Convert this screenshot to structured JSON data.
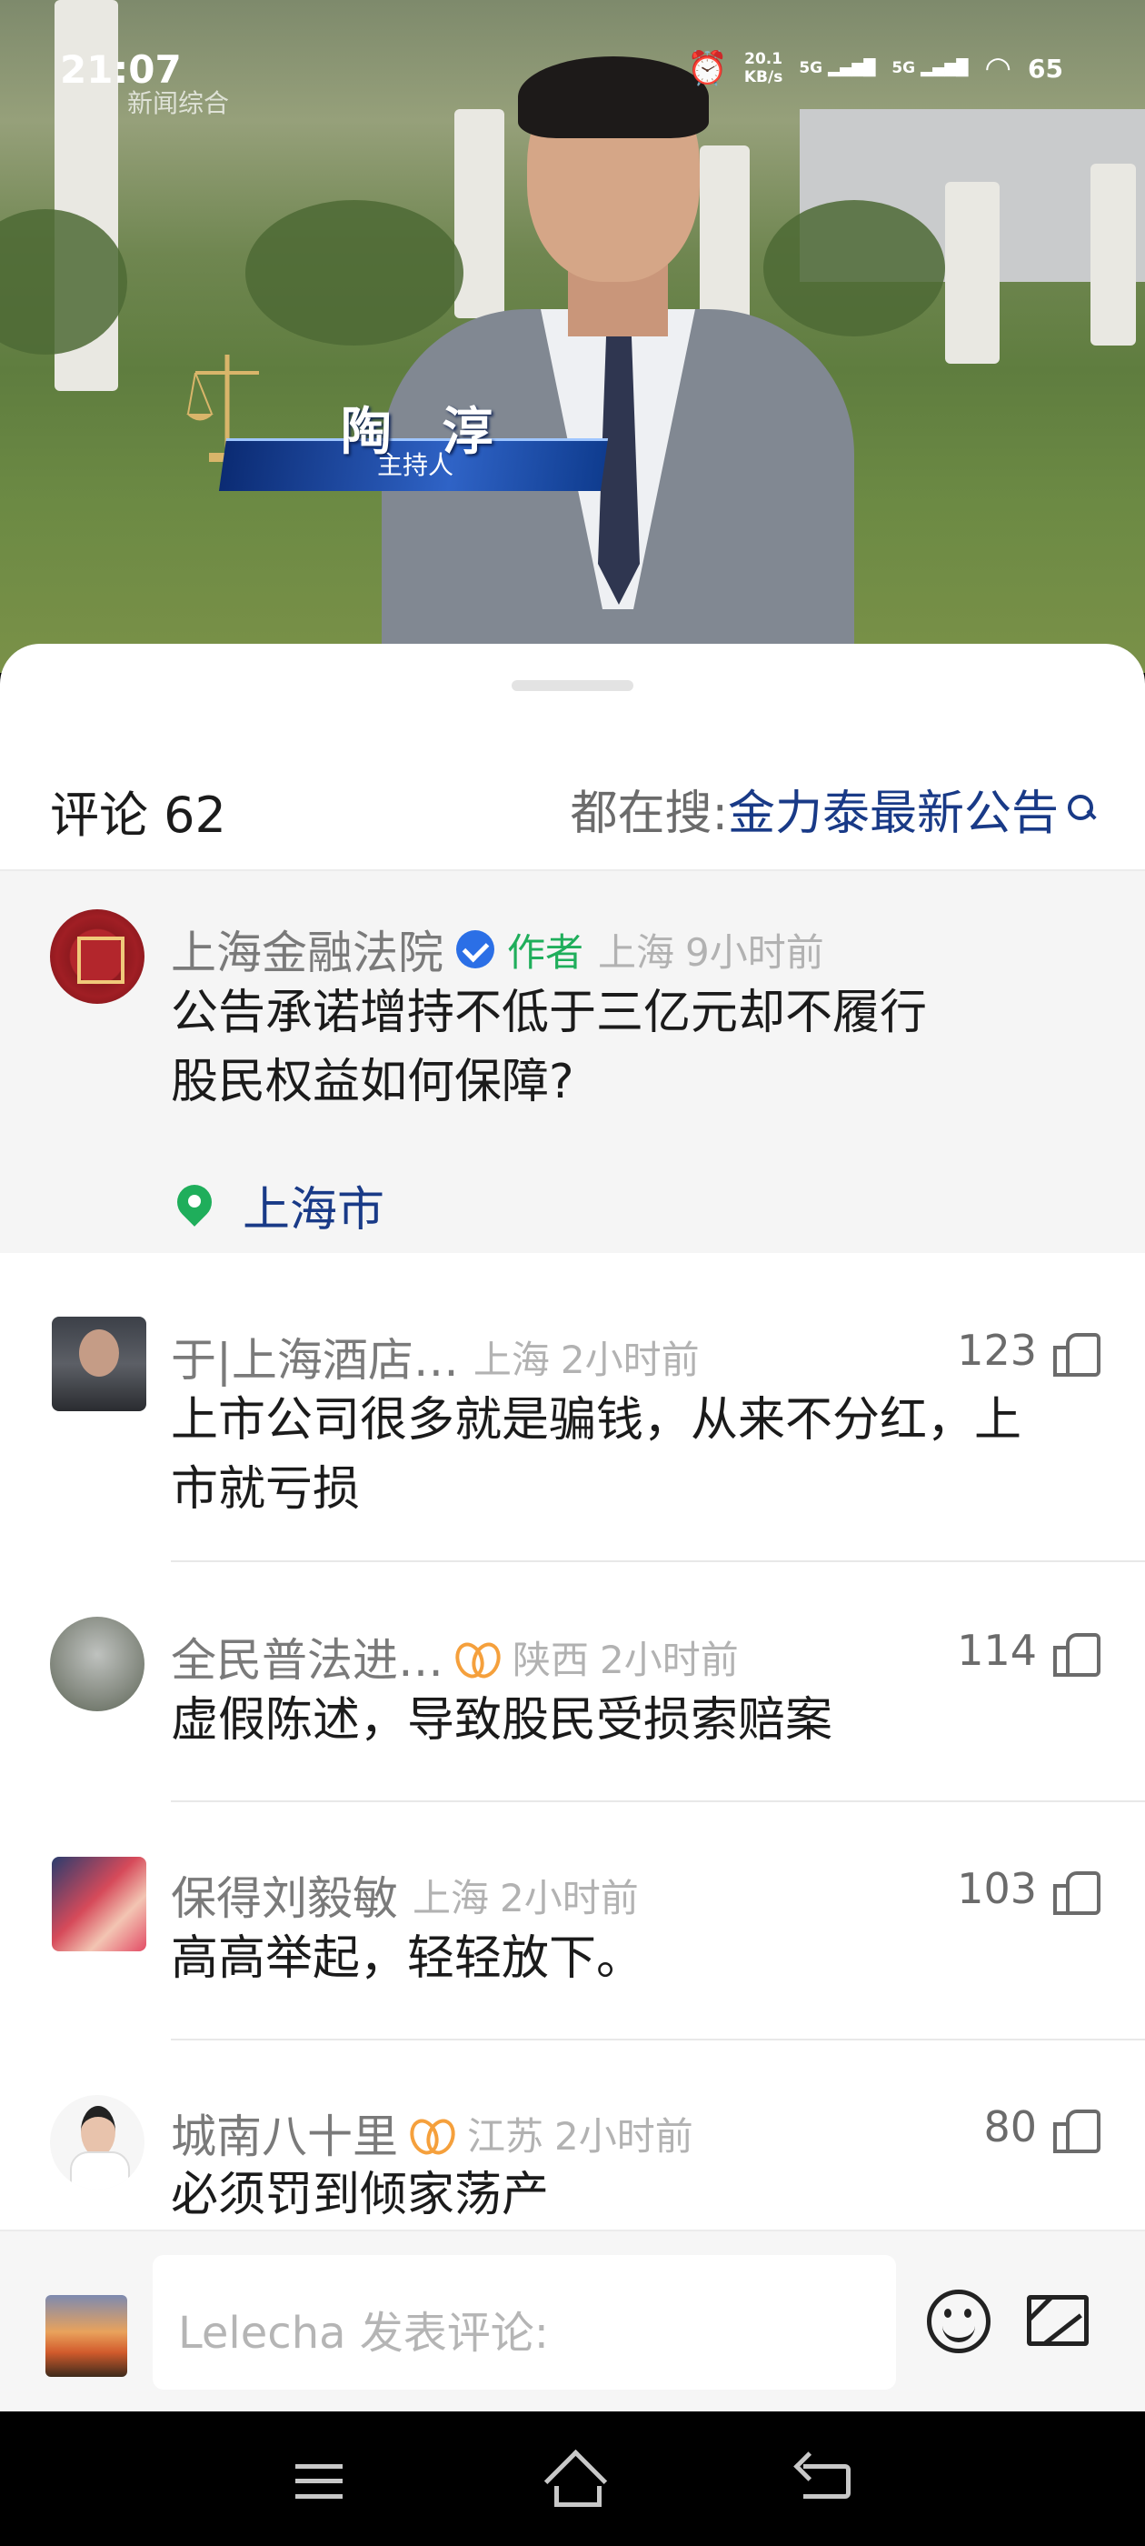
{
  "status_bar": {
    "time": "21:07",
    "watermark": "新闻综合",
    "net_speed_value": "20.1",
    "net_speed_unit": "KB/s",
    "signal_1": "5G",
    "signal_2": "5G",
    "battery": "65"
  },
  "video": {
    "caption_name": "陶 淳",
    "caption_role": "主持人"
  },
  "comments_header": {
    "title": "评论 62",
    "search_label": "都在搜: ",
    "search_term": "金力泰最新公告"
  },
  "pinned_comment": {
    "user": "上海金融法院",
    "author_tag": "作者",
    "region": "上海",
    "time": "9小时前",
    "line1": "公告承诺增持不低于三亿元却不履行",
    "line2": "股民权益如何保障?",
    "location": "上海市"
  },
  "comments": [
    {
      "user": "于|上海酒店…",
      "region": "上海",
      "time": "2小时前",
      "likes": "123",
      "line1": "上市公司很多就是骗钱，从来不分红，上",
      "line2": "市就亏损"
    },
    {
      "user": "全民普法进…",
      "region": "陕西",
      "time": "2小时前",
      "likes": "114",
      "line1": "虚假陈述，导致股民受损索赔案",
      "line2": ""
    },
    {
      "user": "保得刘毅敏",
      "region": "上海",
      "time": "2小时前",
      "likes": "103",
      "line1": "高高举起，轻轻放下。",
      "line2": ""
    },
    {
      "user": "城南八十里",
      "region": "江苏",
      "time": "2小时前",
      "likes": "80",
      "line1": "必须罚到倾家荡产",
      "line2": ""
    }
  ],
  "input_bar": {
    "placeholder": "Lelecha 发表评论:"
  },
  "colors": {
    "accent_blue": "#193a87",
    "author_green": "#1fae5b",
    "verified_blue": "#2b6fe6",
    "badge_orange": "#f5a03c"
  }
}
